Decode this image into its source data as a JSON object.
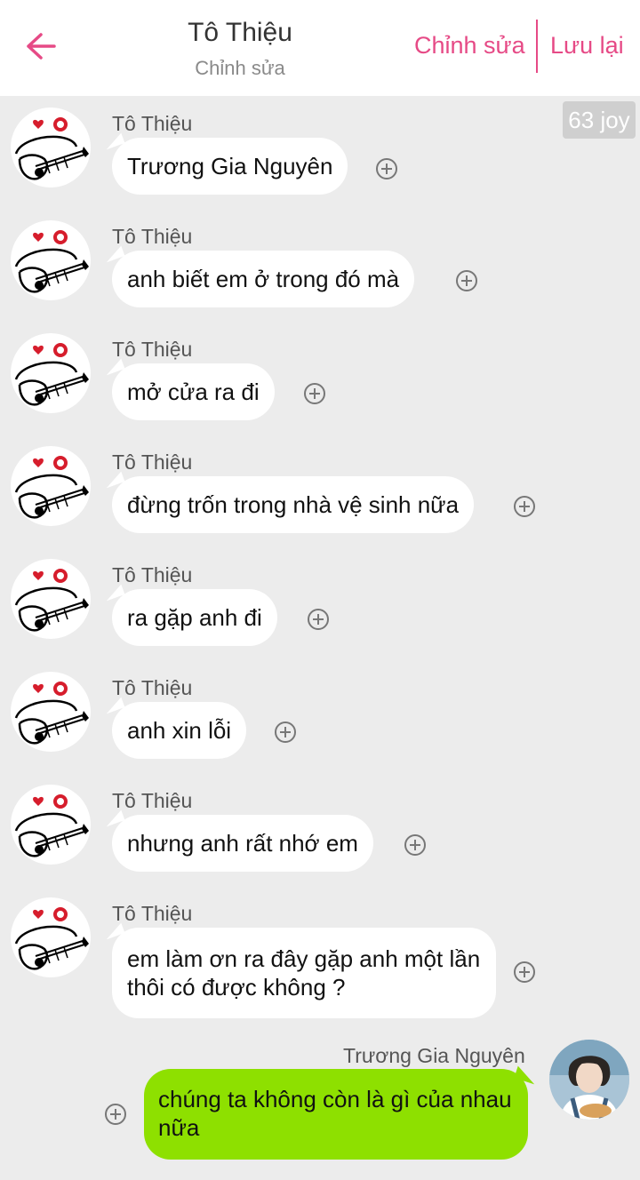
{
  "header": {
    "title": "Tô Thiệu",
    "subtitle": "Chỉnh sửa",
    "edit_label": "Chỉnh sửa",
    "save_label": "Lưu lại",
    "accent_color": "#e64a86"
  },
  "counter": "63 joy",
  "messages": [
    {
      "sender": "Tô Thiệu",
      "text": "Trương Gia Nguyên"
    },
    {
      "sender": "Tô Thiệu",
      "text": "anh biết em ở trong đó mà"
    },
    {
      "sender": "Tô Thiệu",
      "text": "mở cửa ra đi"
    },
    {
      "sender": "Tô Thiệu",
      "text": "đừng trốn trong nhà vệ sinh nữa"
    },
    {
      "sender": "Tô Thiệu",
      "text": "ra gặp anh đi"
    },
    {
      "sender": "Tô Thiệu",
      "text": "anh xin lỗi"
    },
    {
      "sender": "Tô Thiệu",
      "text": "nhưng anh rất nhớ em"
    },
    {
      "sender": "Tô Thiệu",
      "text": "em làm ơn ra đây gặp anh một lần thôi có được không ?"
    }
  ],
  "my_message": {
    "sender": "Trương Gia Nguyên",
    "text": "chúng ta không còn là gì của nhau nữa",
    "bubble_color": "#8ee000"
  },
  "icons": {
    "back": "back-arrow-icon",
    "add": "plus-circle-icon"
  }
}
